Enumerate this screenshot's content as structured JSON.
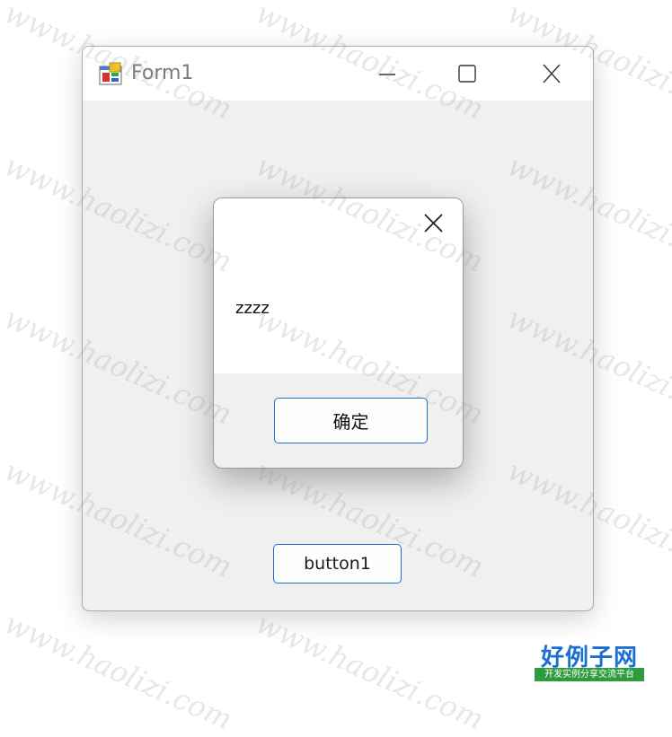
{
  "window": {
    "title": "Form1",
    "button1_label": "button1"
  },
  "messagebox": {
    "text": "zzzz",
    "ok_label": "确定"
  },
  "watermark": {
    "text": "www.haolizi.com",
    "logo_text": "好例子网",
    "logo_subtext": "开发实例分享交流平台"
  },
  "icons": {
    "app": "form-app-icon",
    "minimize": "minimize-icon",
    "maximize": "maximize-icon",
    "close": "close-icon",
    "dialog_close": "dialog-close-icon"
  }
}
